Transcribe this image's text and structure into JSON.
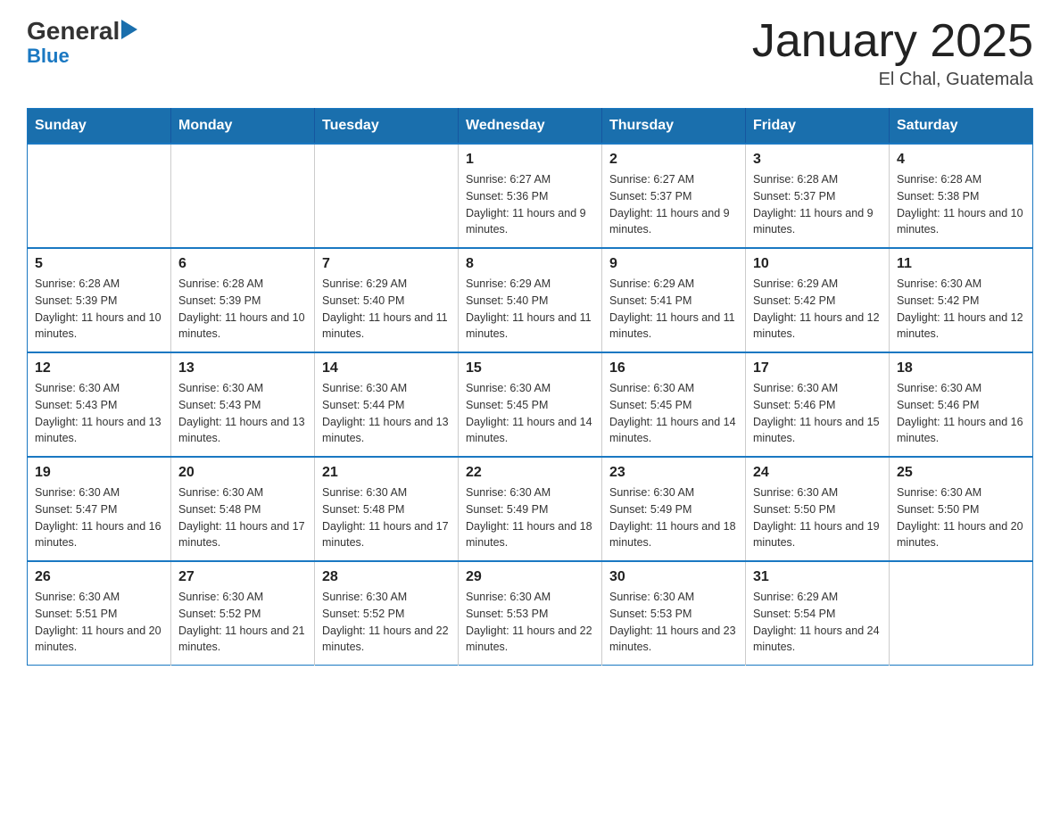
{
  "header": {
    "logo_text": "General",
    "logo_blue": "Blue",
    "month_title": "January 2025",
    "location": "El Chal, Guatemala"
  },
  "weekdays": [
    "Sunday",
    "Monday",
    "Tuesday",
    "Wednesday",
    "Thursday",
    "Friday",
    "Saturday"
  ],
  "weeks": [
    [
      {
        "day": "",
        "info": ""
      },
      {
        "day": "",
        "info": ""
      },
      {
        "day": "",
        "info": ""
      },
      {
        "day": "1",
        "info": "Sunrise: 6:27 AM\nSunset: 5:36 PM\nDaylight: 11 hours and 9 minutes."
      },
      {
        "day": "2",
        "info": "Sunrise: 6:27 AM\nSunset: 5:37 PM\nDaylight: 11 hours and 9 minutes."
      },
      {
        "day": "3",
        "info": "Sunrise: 6:28 AM\nSunset: 5:37 PM\nDaylight: 11 hours and 9 minutes."
      },
      {
        "day": "4",
        "info": "Sunrise: 6:28 AM\nSunset: 5:38 PM\nDaylight: 11 hours and 10 minutes."
      }
    ],
    [
      {
        "day": "5",
        "info": "Sunrise: 6:28 AM\nSunset: 5:39 PM\nDaylight: 11 hours and 10 minutes."
      },
      {
        "day": "6",
        "info": "Sunrise: 6:28 AM\nSunset: 5:39 PM\nDaylight: 11 hours and 10 minutes."
      },
      {
        "day": "7",
        "info": "Sunrise: 6:29 AM\nSunset: 5:40 PM\nDaylight: 11 hours and 11 minutes."
      },
      {
        "day": "8",
        "info": "Sunrise: 6:29 AM\nSunset: 5:40 PM\nDaylight: 11 hours and 11 minutes."
      },
      {
        "day": "9",
        "info": "Sunrise: 6:29 AM\nSunset: 5:41 PM\nDaylight: 11 hours and 11 minutes."
      },
      {
        "day": "10",
        "info": "Sunrise: 6:29 AM\nSunset: 5:42 PM\nDaylight: 11 hours and 12 minutes."
      },
      {
        "day": "11",
        "info": "Sunrise: 6:30 AM\nSunset: 5:42 PM\nDaylight: 11 hours and 12 minutes."
      }
    ],
    [
      {
        "day": "12",
        "info": "Sunrise: 6:30 AM\nSunset: 5:43 PM\nDaylight: 11 hours and 13 minutes."
      },
      {
        "day": "13",
        "info": "Sunrise: 6:30 AM\nSunset: 5:43 PM\nDaylight: 11 hours and 13 minutes."
      },
      {
        "day": "14",
        "info": "Sunrise: 6:30 AM\nSunset: 5:44 PM\nDaylight: 11 hours and 13 minutes."
      },
      {
        "day": "15",
        "info": "Sunrise: 6:30 AM\nSunset: 5:45 PM\nDaylight: 11 hours and 14 minutes."
      },
      {
        "day": "16",
        "info": "Sunrise: 6:30 AM\nSunset: 5:45 PM\nDaylight: 11 hours and 14 minutes."
      },
      {
        "day": "17",
        "info": "Sunrise: 6:30 AM\nSunset: 5:46 PM\nDaylight: 11 hours and 15 minutes."
      },
      {
        "day": "18",
        "info": "Sunrise: 6:30 AM\nSunset: 5:46 PM\nDaylight: 11 hours and 16 minutes."
      }
    ],
    [
      {
        "day": "19",
        "info": "Sunrise: 6:30 AM\nSunset: 5:47 PM\nDaylight: 11 hours and 16 minutes."
      },
      {
        "day": "20",
        "info": "Sunrise: 6:30 AM\nSunset: 5:48 PM\nDaylight: 11 hours and 17 minutes."
      },
      {
        "day": "21",
        "info": "Sunrise: 6:30 AM\nSunset: 5:48 PM\nDaylight: 11 hours and 17 minutes."
      },
      {
        "day": "22",
        "info": "Sunrise: 6:30 AM\nSunset: 5:49 PM\nDaylight: 11 hours and 18 minutes."
      },
      {
        "day": "23",
        "info": "Sunrise: 6:30 AM\nSunset: 5:49 PM\nDaylight: 11 hours and 18 minutes."
      },
      {
        "day": "24",
        "info": "Sunrise: 6:30 AM\nSunset: 5:50 PM\nDaylight: 11 hours and 19 minutes."
      },
      {
        "day": "25",
        "info": "Sunrise: 6:30 AM\nSunset: 5:50 PM\nDaylight: 11 hours and 20 minutes."
      }
    ],
    [
      {
        "day": "26",
        "info": "Sunrise: 6:30 AM\nSunset: 5:51 PM\nDaylight: 11 hours and 20 minutes."
      },
      {
        "day": "27",
        "info": "Sunrise: 6:30 AM\nSunset: 5:52 PM\nDaylight: 11 hours and 21 minutes."
      },
      {
        "day": "28",
        "info": "Sunrise: 6:30 AM\nSunset: 5:52 PM\nDaylight: 11 hours and 22 minutes."
      },
      {
        "day": "29",
        "info": "Sunrise: 6:30 AM\nSunset: 5:53 PM\nDaylight: 11 hours and 22 minutes."
      },
      {
        "day": "30",
        "info": "Sunrise: 6:30 AM\nSunset: 5:53 PM\nDaylight: 11 hours and 23 minutes."
      },
      {
        "day": "31",
        "info": "Sunrise: 6:29 AM\nSunset: 5:54 PM\nDaylight: 11 hours and 24 minutes."
      },
      {
        "day": "",
        "info": ""
      }
    ]
  ]
}
